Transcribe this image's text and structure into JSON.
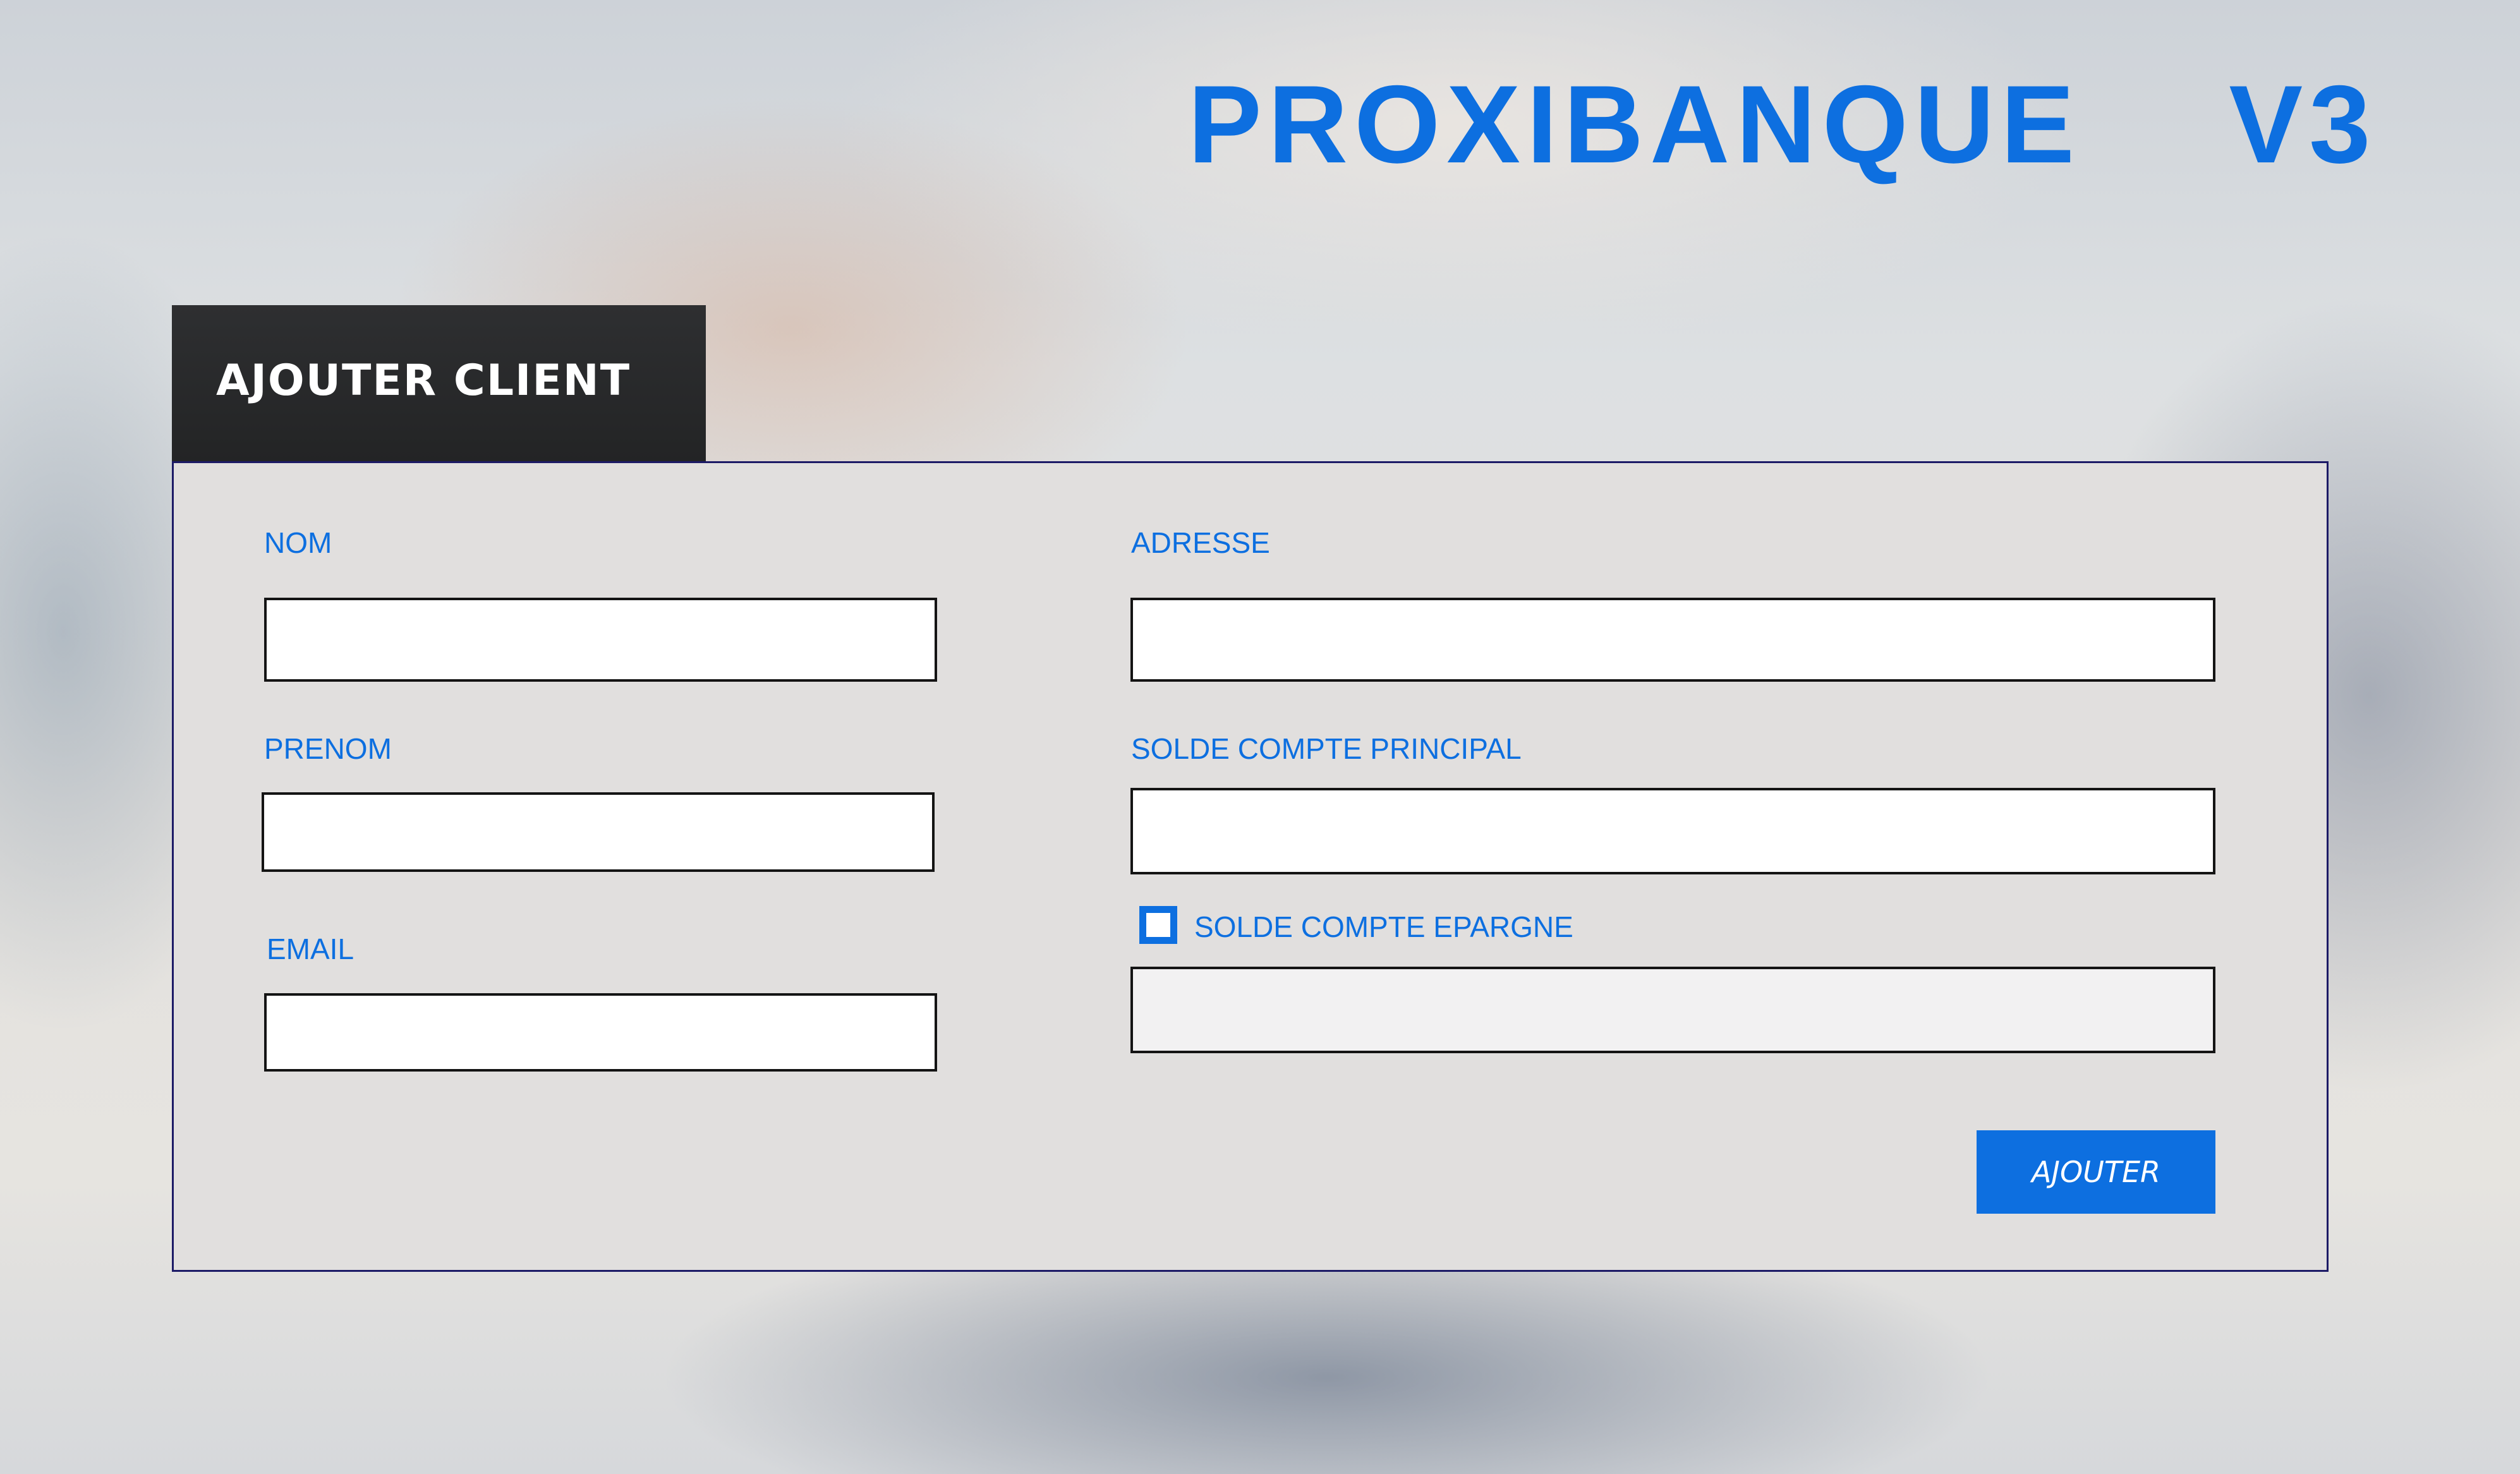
{
  "app": {
    "title": "PROXIBANQUE    V3"
  },
  "form": {
    "header": "AJOUTER CLIENT",
    "fields": {
      "nom": {
        "label": "NOM",
        "value": ""
      },
      "prenom": {
        "label": "PRENOM",
        "value": ""
      },
      "email": {
        "label": "EMAIL",
        "value": ""
      },
      "adresse": {
        "label": "ADRESSE",
        "value": ""
      },
      "solde_principal": {
        "label": "SOLDE COMPTE PRINCIPAL",
        "value": ""
      },
      "solde_epargne": {
        "label": "SOLDE COMPTE EPARGNE",
        "value": "",
        "enabled": false,
        "checked": false
      }
    },
    "submit_label": "AJOUTER"
  },
  "colors": {
    "accent": "#0d6fe0",
    "tab_background": "#2a2b2c",
    "panel_background": "#e1dfde",
    "panel_border": "#1c1a66"
  }
}
